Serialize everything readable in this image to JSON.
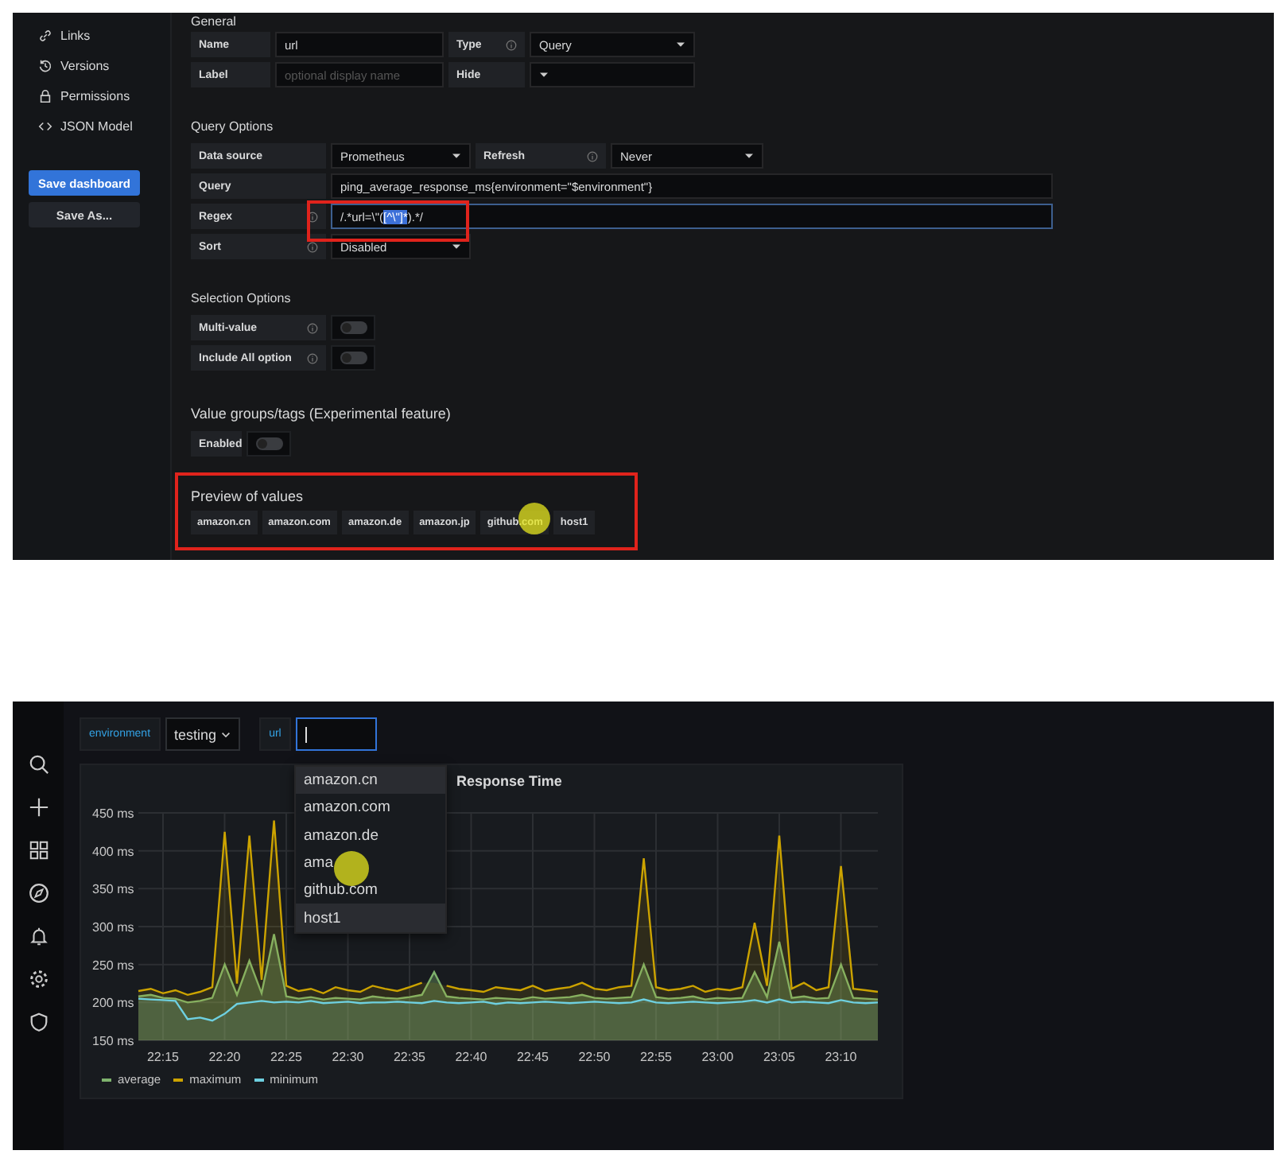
{
  "editor": {
    "sidebar": {
      "items": [
        {
          "label": "Links"
        },
        {
          "label": "Versions"
        },
        {
          "label": "Permissions"
        },
        {
          "label": "JSON Model"
        }
      ],
      "save_button": "Save dashboard",
      "save_as_button": "Save As..."
    },
    "general": {
      "heading": "General",
      "name_label": "Name",
      "name_value": "url",
      "type_label": "Type",
      "type_value": "Query",
      "label_label": "Label",
      "label_placeholder": "optional display name",
      "hide_label": "Hide"
    },
    "query_options": {
      "heading": "Query Options",
      "data_source_label": "Data source",
      "data_source_value": "Prometheus",
      "refresh_label": "Refresh",
      "refresh_value": "Never",
      "query_label": "Query",
      "query_value": "ping_average_response_ms{environment=\"$environment\"}",
      "regex_label": "Regex",
      "regex_parts": [
        {
          "text": "/.*url=\\\"(",
          "selected": false
        },
        {
          "text": "[^\\\"]*",
          "selected": true
        },
        {
          "text": ").*/",
          "selected": false
        }
      ],
      "sort_label": "Sort",
      "sort_value": "Disabled"
    },
    "selection_options": {
      "heading": "Selection Options",
      "options": [
        {
          "label": "Multi-value",
          "on": false
        },
        {
          "label": "Include All option",
          "on": false
        }
      ]
    },
    "value_groups": {
      "heading": "Value groups/tags (Experimental feature)",
      "enabled_label": "Enabled",
      "on": false
    },
    "preview": {
      "heading": "Preview of values",
      "values": [
        "amazon.cn",
        "amazon.com",
        "amazon.de",
        "amazon.jp",
        "github.com",
        "host1"
      ]
    }
  },
  "dashboard": {
    "variables": [
      {
        "label": "environment",
        "kind": "select",
        "value": "testing"
      },
      {
        "label": "url",
        "kind": "input"
      }
    ],
    "dropdown": {
      "items": [
        {
          "label": "amazon.cn",
          "highlighted": true
        },
        {
          "label": "amazon.com",
          "highlighted": false
        },
        {
          "label": "amazon.de",
          "highlighted": false
        },
        {
          "label": "ama",
          "highlighted": false
        },
        {
          "label": "github.com",
          "highlighted": false
        },
        {
          "label": "host1",
          "highlighted": true
        }
      ]
    },
    "panel": {
      "chart_data": {
        "type": "area",
        "title": "Response Time",
        "categories": [
          null,
          null,
          "22:15",
          null,
          null,
          null,
          null,
          "22:20",
          null,
          null,
          null,
          null,
          "22:25",
          null,
          null,
          null,
          null,
          "22:30",
          null,
          null,
          null,
          null,
          "22:35",
          null,
          null,
          null,
          null,
          "22:40",
          null,
          null,
          null,
          null,
          "22:45",
          null,
          null,
          null,
          null,
          "22:50",
          null,
          null,
          null,
          null,
          "22:55",
          null,
          null,
          null,
          null,
          "23:00",
          null,
          null,
          null,
          null,
          "23:05",
          null,
          null,
          null,
          null,
          "23:10",
          null,
          null,
          null
        ],
        "ylim": [
          150,
          450
        ],
        "grid": true,
        "yticks": [
          {
            "value": 150,
            "label": "150 ms"
          },
          {
            "value": 200,
            "label": "200 ms"
          },
          {
            "value": 250,
            "label": "250 ms"
          },
          {
            "value": 300,
            "label": "300 ms"
          },
          {
            "value": 350,
            "label": "350 ms"
          },
          {
            "value": 400,
            "label": "400 ms"
          },
          {
            "value": 450,
            "label": "450 ms"
          }
        ],
        "series": [
          {
            "name": "average",
            "color": "#7eb26d",
            "values": [
              208,
              210,
              206,
              205,
              200,
              202,
              206,
              250,
              210,
              255,
              212,
              290,
              208,
              205,
              207,
              204,
              206,
              205,
              204,
              208,
              206,
              205,
              207,
              210,
              240,
              208,
              206,
              205,
              204,
              206,
              205,
              204,
              207,
              205,
              206,
              207,
              210,
              206,
              205,
              206,
              207,
              250,
              207,
              205,
              206,
              208,
              204,
              206,
              205,
              206,
              240,
              207,
              280,
              206,
              208,
              205,
              206,
              250,
              206,
              205,
              204
            ]
          },
          {
            "name": "maximum",
            "color": "#cca300",
            "values": [
              215,
              218,
              212,
              216,
              210,
              214,
              220,
              425,
              225,
              420,
              230,
              440,
              222,
              215,
              218,
              212,
              220,
              216,
              214,
              222,
              218,
              215,
              220,
              226,
              null,
              222,
              218,
              216,
              214,
              220,
              218,
              216,
              222,
              215,
              218,
              220,
              226,
              218,
              216,
              220,
              222,
              390,
              220,
              216,
              218,
              222,
              214,
              218,
              216,
              220,
              305,
              222,
              420,
              218,
              226,
              216,
              220,
              380,
              218,
              216,
              214
            ]
          },
          {
            "name": "minimum",
            "color": "#6ed0e0",
            "values": [
              205,
              204,
              203,
              202,
              178,
              180,
              176,
              185,
              198,
              200,
              202,
              200,
              201,
              200,
              202,
              199,
              200,
              201,
              199,
              200,
              200,
              201,
              200,
              199,
              202,
              200,
              199,
              200,
              201,
              198,
              200,
              199,
              200,
              201,
              200,
              199,
              200,
              201,
              200,
              199,
              200,
              204,
              200,
              199,
              200,
              201,
              200,
              199,
              200,
              201,
              203,
              200,
              204,
              200,
              201,
              200,
              199,
              203,
              200,
              199,
              200
            ]
          }
        ]
      }
    }
  }
}
